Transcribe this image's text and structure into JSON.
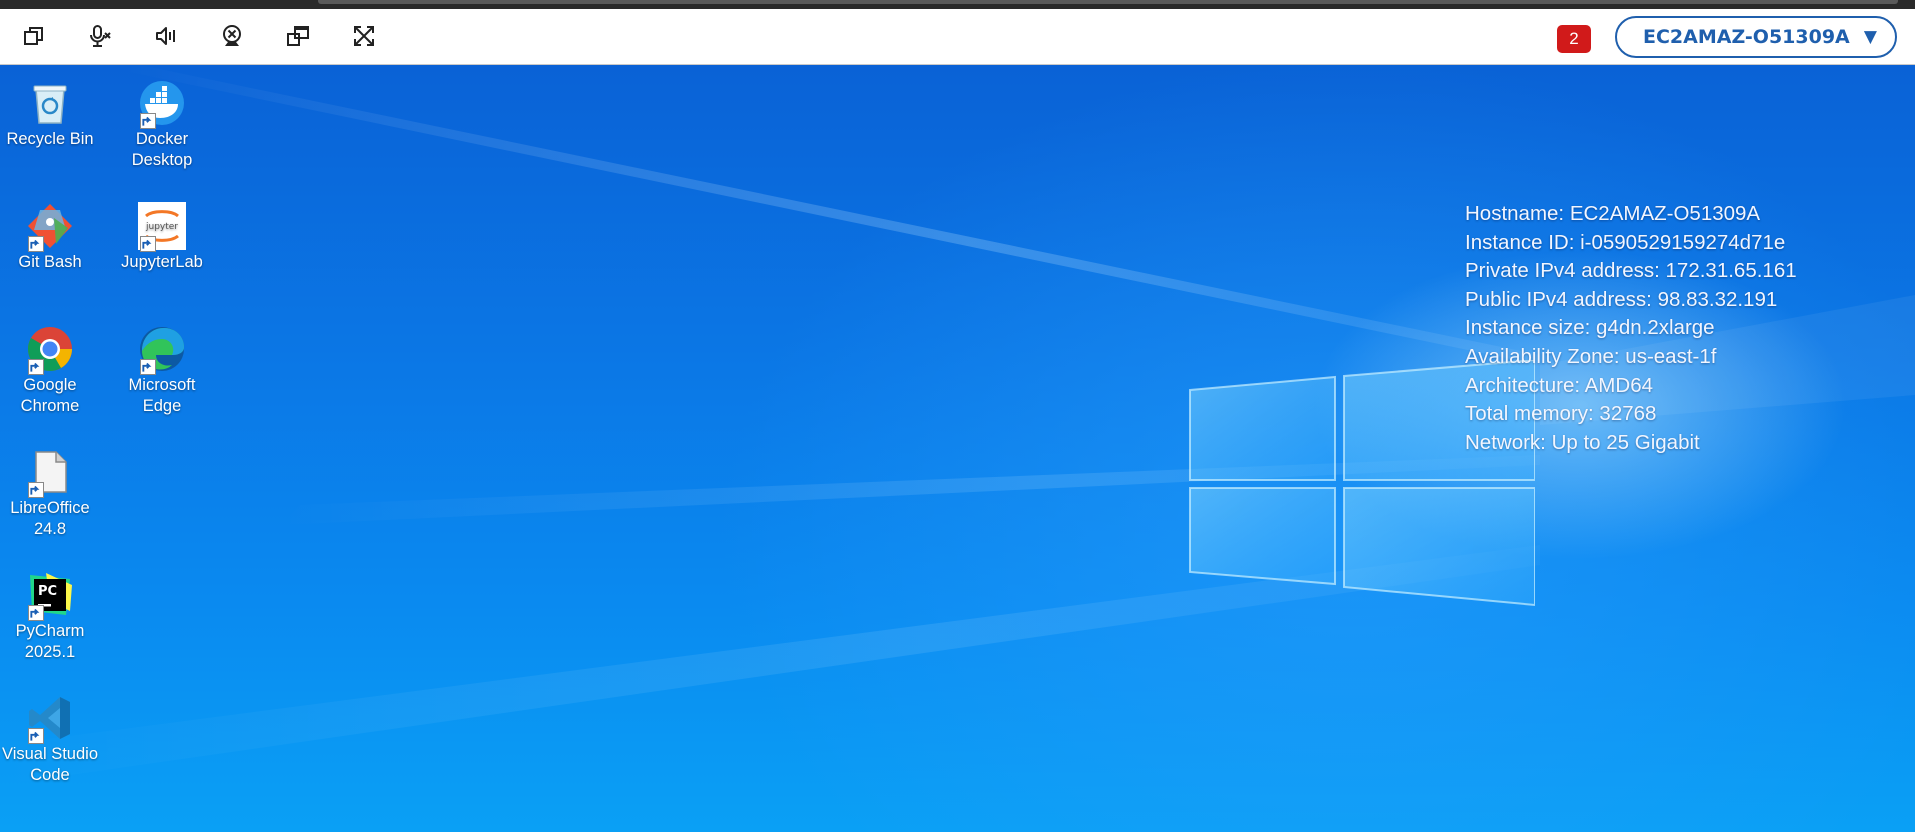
{
  "toolbar": {
    "buttons": [
      {
        "name": "multi-monitor-icon"
      },
      {
        "name": "microphone-muted-icon"
      },
      {
        "name": "speaker-icon"
      },
      {
        "name": "webcam-icon"
      },
      {
        "name": "window-switch-icon"
      },
      {
        "name": "fullscreen-icon"
      }
    ],
    "notification_count": "2",
    "host_selector": {
      "value": "EC2AMAZ-O51309A",
      "caret": "▼"
    }
  },
  "desktop": {
    "icons": [
      {
        "label": "Recycle Bin",
        "icon": "recycle-bin-icon"
      },
      {
        "label": "Docker Desktop",
        "icon": "docker-icon"
      },
      {
        "label": "Git Bash",
        "icon": "git-bash-icon"
      },
      {
        "label": "JupyterLab",
        "icon": "jupyter-icon"
      },
      {
        "label": "Google Chrome",
        "icon": "chrome-icon"
      },
      {
        "label": "Microsoft Edge",
        "icon": "edge-icon"
      },
      {
        "label": "LibreOffice 24.8",
        "icon": "libreoffice-icon"
      },
      {
        "label": "PyCharm 2025.1",
        "icon": "pycharm-icon"
      },
      {
        "label": "Visual Studio Code",
        "icon": "vscode-icon"
      }
    ],
    "sysinfo": [
      "Hostname: EC2AMAZ-O51309A",
      "Instance ID: i-0590529159274d71e",
      "Private IPv4 address: 172.31.65.161",
      "Public IPv4 address: 98.83.32.191",
      "Instance size: g4dn.2xlarge",
      "Availability Zone: us-east-1f",
      "Architecture: AMD64",
      "Total memory: 32768",
      "Network: Up to 25 Gigabit"
    ],
    "jupyter_icon_text": "jupyter",
    "pycharm_icon_text": "PC"
  },
  "colors": {
    "accent": "#1f5fad",
    "badge": "#d11a1a",
    "desktop_blue": "#0a78e6"
  }
}
